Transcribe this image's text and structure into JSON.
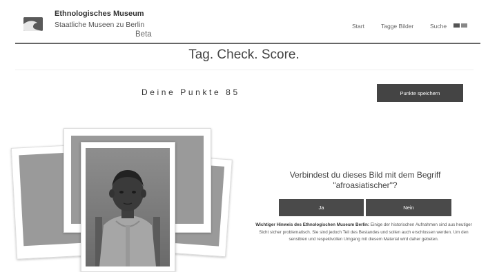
{
  "header": {
    "museum_name": "Ethnologisches Museum",
    "museum_sub": "Staatliche Museen zu Berlin",
    "beta": "Beta",
    "logo_icon": "wave-logo-icon",
    "nav": [
      {
        "label": "Start"
      },
      {
        "label": "Tagge Bilder"
      },
      {
        "label": "Suche"
      }
    ],
    "language_icons": [
      "flag-de-icon",
      "flag-en-icon"
    ]
  },
  "title": "Tag. Check. Score.",
  "score": {
    "label": "Deine Punkte 85",
    "save_label": "Punkte speichern"
  },
  "question": {
    "text": "Verbindest du dieses Bild mit dem Begriff \"afroasiatischer\"?",
    "yes_label": "Ja",
    "no_label": "Nein"
  },
  "notice": {
    "bold": "Wichtiger Hinweis des Ethnologischen Museum Berlin:",
    "text": " Einige der historischen Aufnahmen sind aus heutiger Sicht sicher problematisch. Sie sind jedoch Teil des Bestandes und sollen auch erschlossen werden. Um den sensiblen und respektvollen Umgang mit diesem Material wird daher gebeten."
  },
  "colors": {
    "button_bg": "#4a4a4a",
    "header_rule": "#666666"
  }
}
